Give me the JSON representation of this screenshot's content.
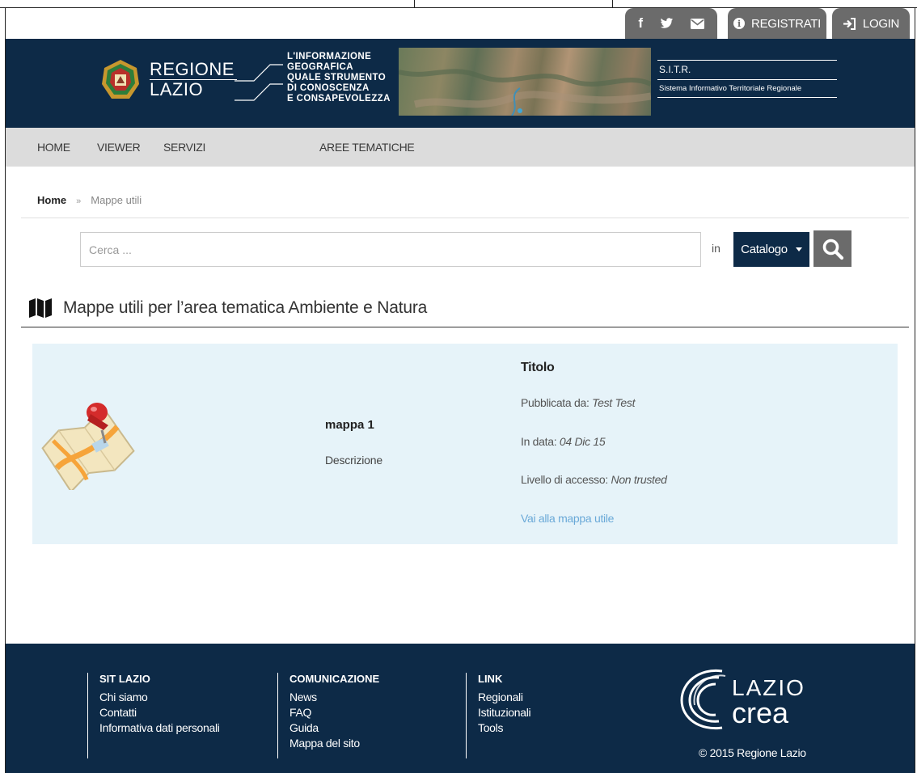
{
  "topbar": {
    "social_icons": [
      "facebook-icon",
      "twitter-icon",
      "envelope-icon"
    ],
    "social_glyphs": [
      "f",
      "🐦",
      "✉"
    ],
    "registrati_label": "REGISTRATI",
    "login_label": "LOGIN"
  },
  "banner": {
    "brand_line1": "REGIONE",
    "brand_line2": "LAZIO",
    "tagline": [
      "L'INFORMAZIONE",
      "GEOGRAFICA",
      "QUALE STRUMENTO",
      "DI CONOSCENZA",
      "E CONSAPEVOLEZZA"
    ],
    "sitr_title": "S.I.T.R.",
    "sitr_subtitle": "Sistema Informativo Territoriale Regionale"
  },
  "nav": {
    "items": [
      "HOME",
      "VIEWER",
      "SERVIZI",
      "AREE TEMATICHE"
    ]
  },
  "breadcrumb": {
    "home": "Home",
    "separator": "»",
    "current": "Mappe utili"
  },
  "search": {
    "placeholder": "Cerca ...",
    "value": "",
    "in_label": "in",
    "scope_label": "Catalogo"
  },
  "section": {
    "title": "Mappe utili per l’area tematica Ambiente e Natura"
  },
  "result": {
    "name": "mappa 1",
    "description": "Descrizione",
    "details_title": "Titolo",
    "published_by_label": "Pubblicata da:",
    "published_by_value": "Test Test",
    "date_label": "In data:",
    "date_value": "04 Dic 15",
    "access_label": "Livello di accesso:",
    "access_value": "Non trusted",
    "link_label": "Vai alla mappa utile"
  },
  "footer": {
    "columns": [
      {
        "heading": "SIT LAZIO",
        "items": [
          "Chi siamo",
          "Contatti",
          "Informativa dati personali"
        ]
      },
      {
        "heading": "COMUNICAZIONE",
        "items": [
          "News",
          "FAQ",
          "Guida",
          "Mappa del sito"
        ]
      },
      {
        "heading": "LINK",
        "items": [
          "Regionali",
          "Istituzionali",
          "Tools"
        ]
      }
    ],
    "logo_line1": "LAZIO",
    "logo_line2": "crea",
    "copyright": "© 2015 Regione Lazio"
  },
  "colors": {
    "navy": "#0d2a47",
    "tab_gray": "#6b6b6b",
    "nav_gray": "#dcdcdc",
    "card_bg": "#e6f3f9",
    "link_blue": "#6aa9d8"
  }
}
